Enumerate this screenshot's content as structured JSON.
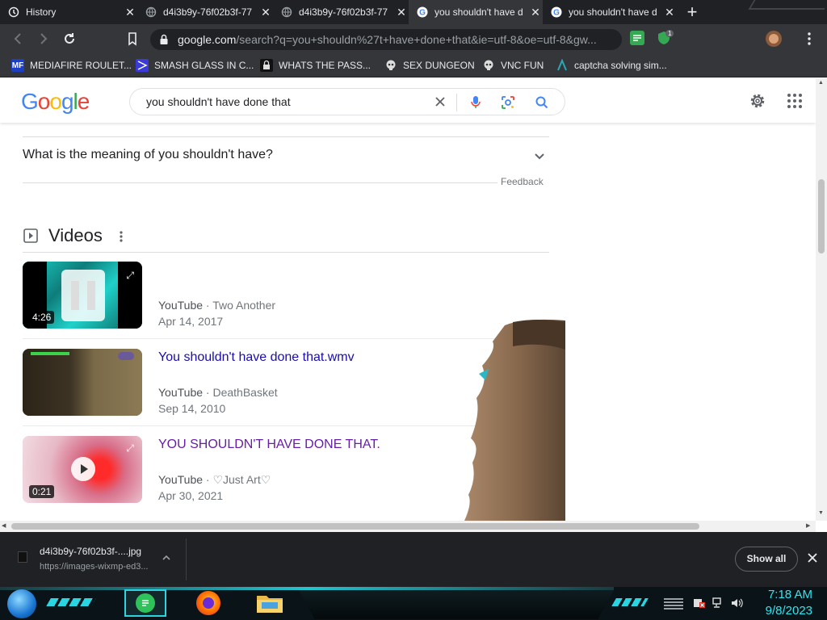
{
  "tabs": [
    {
      "title": "History",
      "icon": "history-icon",
      "active": false
    },
    {
      "title": "d4i3b9y-76f02b3f-77",
      "icon": "globe-icon",
      "active": false
    },
    {
      "title": "d4i3b9y-76f02b3f-77",
      "icon": "globe-icon",
      "active": false
    },
    {
      "title": "you shouldn't have d",
      "icon": "google-icon",
      "active": true
    },
    {
      "title": "you shouldn't have d",
      "icon": "google-icon",
      "active": false
    }
  ],
  "new_tab_symbol": "+",
  "address": {
    "domain": "google.com",
    "path": "/search?q=you+shouldn%27t+have+done+that&ie=utf-8&oe=utf-8&gw..."
  },
  "extension_badge": "1",
  "bookmarks": [
    {
      "label": "MEDIAFIRE ROULET...",
      "icon": "mediafire-icon",
      "icon_text": "MF",
      "color": "#1c3fc4"
    },
    {
      "label": "SMASH GLASS IN C...",
      "icon": "glass-icon",
      "icon_text": "",
      "color": "#3a3ad8"
    },
    {
      "label": "WHATS THE PASS...",
      "icon": "lock-icon",
      "icon_text": "",
      "color": "#111111"
    },
    {
      "label": "SEX DUNGEON",
      "icon": "skull-icon",
      "icon_text": "",
      "color": "#555555"
    },
    {
      "label": "VNC FUN",
      "icon": "skull-icon",
      "icon_text": "",
      "color": "#555555"
    },
    {
      "label": "captcha solving sim...",
      "icon": "caret-icon",
      "icon_text": "",
      "color": "#2aa7b5"
    }
  ],
  "google": {
    "logo": "Google",
    "query": "you shouldn't have done that"
  },
  "faq": {
    "question": "What is the meaning of you shouldn't have?",
    "feedback": "Feedback"
  },
  "videos": {
    "heading": "Videos",
    "items": [
      {
        "title": "",
        "source": "YouTube",
        "channel": "Two Another",
        "date": "Apr 14, 2017",
        "duration": "4:26"
      },
      {
        "title": "You shouldn't have done that.wmv",
        "source": "YouTube",
        "channel": "DeathBasket",
        "date": "Sep 14, 2010",
        "duration": ""
      },
      {
        "title": "YOU SHOULDN'T HAVE DONE THAT.",
        "source": "YouTube",
        "channel": "♡Just Art♡",
        "date": "Apr 30, 2021",
        "duration": "0:21"
      }
    ],
    "separator": " · "
  },
  "download": {
    "filename": "d4i3b9y-76f02b3f-....jpg",
    "url": "https://images-wixmp-ed3...",
    "show_all": "Show all"
  },
  "taskbar": {
    "time": "7:18 AM",
    "date": "9/8/2023"
  },
  "colors": {
    "chrome_dark": "#202124",
    "chrome_mid": "#35363a",
    "link_blue": "#1a0dab",
    "link_visited": "#681da8",
    "clock_cyan": "#2ee6f0"
  }
}
